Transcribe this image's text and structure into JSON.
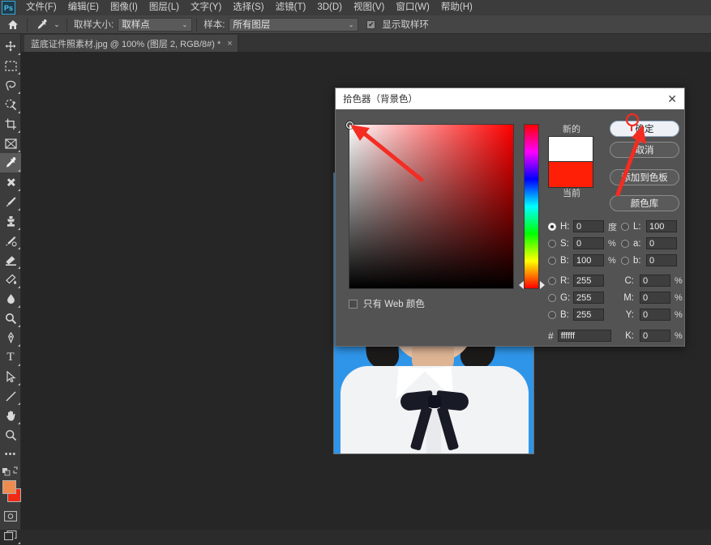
{
  "app": {
    "logo_text": "Ps"
  },
  "menubar": {
    "items": [
      {
        "label": "文件(F)"
      },
      {
        "label": "编辑(E)"
      },
      {
        "label": "图像(I)"
      },
      {
        "label": "图层(L)"
      },
      {
        "label": "文字(Y)"
      },
      {
        "label": "选择(S)"
      },
      {
        "label": "滤镜(T)"
      },
      {
        "label": "3D(D)"
      },
      {
        "label": "视图(V)"
      },
      {
        "label": "窗口(W)"
      },
      {
        "label": "帮助(H)"
      }
    ]
  },
  "optionsbar": {
    "home_icon": "home-icon",
    "tool_icon": "eyedropper-icon",
    "sample_size_label": "取样大小:",
    "sample_size_value": "取样点",
    "sample_label": "样本:",
    "sample_value": "所有图层",
    "show_ring_label": "显示取样环",
    "show_ring_checked": true,
    "caret": "⌄"
  },
  "tabbar": {
    "document_title": "蓝底证件照素材.jpg @ 100% (图层 2, RGB/8#) *",
    "close_glyph": "×"
  },
  "toolbar": {
    "tools": [
      {
        "name": "move-tool"
      },
      {
        "name": "rectangular-marquee-tool"
      },
      {
        "name": "lasso-tool"
      },
      {
        "name": "quick-selection-tool"
      },
      {
        "name": "crop-tool"
      },
      {
        "name": "frame-tool"
      },
      {
        "name": "eyedropper-tool",
        "selected": true
      },
      {
        "name": "spot-healing-brush-tool"
      },
      {
        "name": "brush-tool"
      },
      {
        "name": "clone-stamp-tool"
      },
      {
        "name": "history-brush-tool"
      },
      {
        "name": "eraser-tool"
      },
      {
        "name": "gradient-tool"
      },
      {
        "name": "blur-tool"
      },
      {
        "name": "dodge-tool"
      },
      {
        "name": "pen-tool"
      },
      {
        "name": "type-tool"
      },
      {
        "name": "path-selection-tool"
      },
      {
        "name": "line-tool"
      },
      {
        "name": "hand-tool"
      },
      {
        "name": "zoom-tool"
      },
      {
        "name": "edit-toolbar-tool"
      }
    ],
    "type_tool_glyph": "T",
    "more_glyph": "•••",
    "foreground_color": "#ee8b4f",
    "background_color": "#f02b15"
  },
  "picker": {
    "title": "拾色器（背景色）",
    "close_glyph": "✕",
    "new_label": "新的",
    "current_label": "当前",
    "new_color": "#ffffff",
    "current_color": "#fe1f06",
    "buttons": {
      "ok": "确定",
      "cancel": "取消",
      "add_to_swatches": "添加到色板",
      "color_libraries": "颜色库"
    },
    "web_only_label": "只有 Web 颜色",
    "web_only_checked": false,
    "hex_symbol": "#",
    "hex_value": "ffffff",
    "fields": {
      "H": {
        "label": "H:",
        "value": "0",
        "unit": "度",
        "selected": true
      },
      "S": {
        "label": "S:",
        "value": "0",
        "unit": "%",
        "selected": false
      },
      "B": {
        "label": "B:",
        "value": "100",
        "unit": "%",
        "selected": false
      },
      "R": {
        "label": "R:",
        "value": "255",
        "unit": "",
        "selected": false
      },
      "G": {
        "label": "G:",
        "value": "255",
        "unit": "",
        "selected": false
      },
      "Bb": {
        "label": "B:",
        "value": "255",
        "unit": "",
        "selected": false
      },
      "L": {
        "label": "L:",
        "value": "100",
        "unit": "",
        "selected": false
      },
      "a": {
        "label": "a:",
        "value": "0",
        "unit": "",
        "selected": false
      },
      "b": {
        "label": "b:",
        "value": "0",
        "unit": "",
        "selected": false
      },
      "C": {
        "label": "C:",
        "value": "0",
        "unit": "%"
      },
      "M": {
        "label": "M:",
        "value": "0",
        "unit": "%"
      },
      "Y": {
        "label": "Y:",
        "value": "0",
        "unit": "%"
      },
      "K": {
        "label": "K:",
        "value": "0",
        "unit": "%"
      }
    }
  },
  "canvas": {
    "photo_background_color": "#2f95e8",
    "shirt_color": "#f2f3f5",
    "tie_color": "#181b26",
    "skin_color": "#e8c3a8",
    "hair_color": "#1d1a1a"
  },
  "annotations": {
    "arrow_color": "#f42c22",
    "arrows": [
      {
        "name": "arrow-to-color-field",
        "points_to": "color-field-top-left-marker"
      },
      {
        "name": "arrow-to-ok-button",
        "points_to": "ok-button"
      }
    ],
    "cursor": {
      "name": "cursor-marker",
      "on": "ok-button"
    }
  }
}
